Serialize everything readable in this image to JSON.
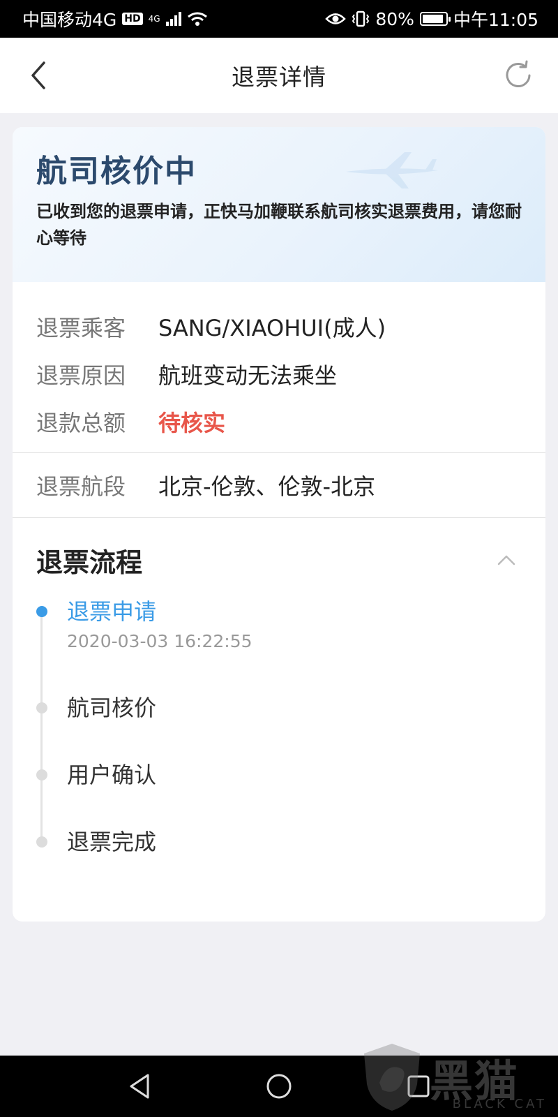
{
  "status_bar": {
    "carrier": "中国移动4G",
    "hd": "HD",
    "signal_sup": "4G",
    "battery": "80%",
    "time": "中午11:05"
  },
  "header": {
    "title": "退票详情",
    "back_icon": "back-arrow-icon",
    "refresh_icon": "refresh-icon"
  },
  "banner": {
    "status_title": "航司核价中",
    "status_desc": "已收到您的退票申请，正快马加鞭联系航司核实退票费用，请您耐心等待"
  },
  "info": [
    {
      "label": "退票乘客",
      "value": "SANG/XIAOHUI(成人)"
    },
    {
      "label": "退票原因",
      "value": "航班变动无法乘坐"
    },
    {
      "label": "退款总额",
      "value": "待核实"
    }
  ],
  "segment": {
    "label": "退票航段",
    "value": "北京-伦敦、伦敦-北京"
  },
  "process": {
    "title": "退票流程",
    "steps": [
      {
        "label": "退票申请",
        "time": "2020-03-03 16:22:55",
        "active": true
      },
      {
        "label": "航司核价",
        "active": false
      },
      {
        "label": "用户确认",
        "active": false
      },
      {
        "label": "退票完成",
        "active": false
      }
    ]
  },
  "watermark": {
    "logo": "黑猫",
    "sub": "BLACK CAT"
  },
  "colors": {
    "accent": "#3a9be6",
    "status_title": "#2c4a6d",
    "pending": "#e8564a",
    "background": "#f0f0f4"
  }
}
